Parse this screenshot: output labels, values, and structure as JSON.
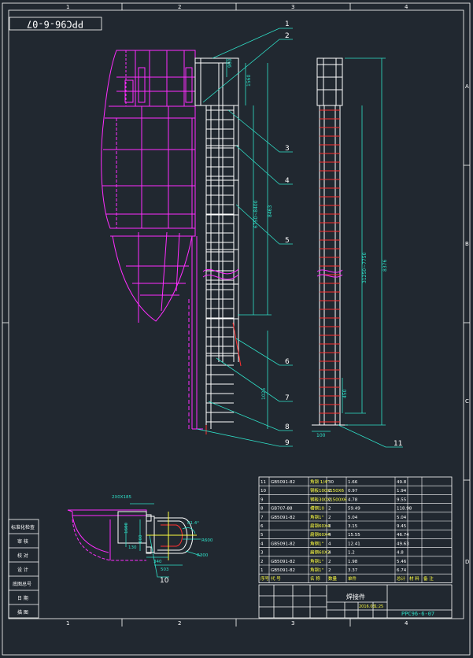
{
  "drawing_number_rotated": "PPC96-6-07",
  "drawing_number": "PPC96-6-07",
  "title_block": {
    "title": "焊接件",
    "scale": "1:25",
    "date": "2016.03",
    "signoff": [
      "标准化检查",
      "审 核",
      "校 对",
      "设 计",
      "描 图",
      "底图总号",
      "日 期"
    ]
  },
  "border": {
    "col_marks": [
      "1",
      "2",
      "3",
      "4"
    ],
    "row_marks": [
      "A",
      "B",
      "C",
      "D"
    ]
  },
  "callouts": [
    "1",
    "2",
    "3",
    "4",
    "5",
    "6",
    "7",
    "8",
    "9",
    "10",
    "11"
  ],
  "dimensions": {
    "d_900": "900",
    "d_1560": "1560",
    "d_6750_8400": "6750~8400",
    "d_8463": "8463",
    "d_31250_7750": "31250~7750",
    "d_8376": "8376",
    "d_1025": "1025",
    "d_450": "450",
    "d_100": "100",
    "d_1600": "1600",
    "d_R600": "R600",
    "d_R300": "R300",
    "d_130": "130",
    "d_660": "660",
    "d_340": "340",
    "d_503": "503",
    "d_81": "81.4°",
    "d_top": "2X0X185"
  },
  "parts": [
    {
      "no": "11",
      "std": "GB5091-82",
      "name": "角钢 1/4\"",
      "qty": "30",
      "w1": "1.66",
      "w2": "49.8"
    },
    {
      "no": "10",
      "std": "",
      "name": "钢板100X150X6",
      "qty": "2",
      "w1": "0.97",
      "w2": "1.94"
    },
    {
      "no": "9",
      "std": "",
      "name": "钢板300X1500X6",
      "qty": "2",
      "w1": "4.78",
      "w2": "9.55"
    },
    {
      "no": "8",
      "std": "GB707-88",
      "name": "槽钢10",
      "qty": "2",
      "w1": "59.49",
      "w2": "118.98"
    },
    {
      "no": "7",
      "std": "GB5091-82",
      "name": "角钢1\"",
      "qty": "2",
      "w1": "5.04",
      "w2": "5.04"
    },
    {
      "no": "6",
      "std": "",
      "name": "扁钢60X4",
      "qty": "3",
      "w1": "3.15",
      "w2": "9.45"
    },
    {
      "no": "5",
      "std": "",
      "name": "扁钢60X4",
      "qty": "4",
      "w1": "15.55",
      "w2": "46.74"
    },
    {
      "no": "4",
      "std": "GB5091-82",
      "name": "角钢1\"",
      "qty": "4",
      "w1": "12.41",
      "w2": "49.63"
    },
    {
      "no": "3",
      "std": "",
      "name": "扁钢60X3",
      "qty": "4",
      "w1": "1.2",
      "w2": "4.8"
    },
    {
      "no": "2",
      "std": "GB5091-82",
      "name": "角钢1\"",
      "qty": "2",
      "w1": "1.98",
      "w2": "5.46"
    },
    {
      "no": "1",
      "std": "GB5091-82",
      "name": "角钢1\"",
      "qty": "2",
      "w1": "3.37",
      "w2": "6.74"
    }
  ],
  "parts_header": {
    "no": "序号",
    "std": "代 号",
    "name": "名 称",
    "qty": "数量",
    "w1": "单件",
    "w2": "总计",
    "mat": "材 料",
    "note": "备 注"
  },
  "colors": {
    "background": "#212830",
    "border": "#ffffff",
    "structure": "#ff2dff",
    "ladder": "#ffffff",
    "dimension": "#2fe0c8",
    "leader": "#2fe0c8",
    "table_text": "#ffffff",
    "table_line": "#ffffff",
    "red": "#ff3030",
    "yellow": "#ffff40"
  }
}
